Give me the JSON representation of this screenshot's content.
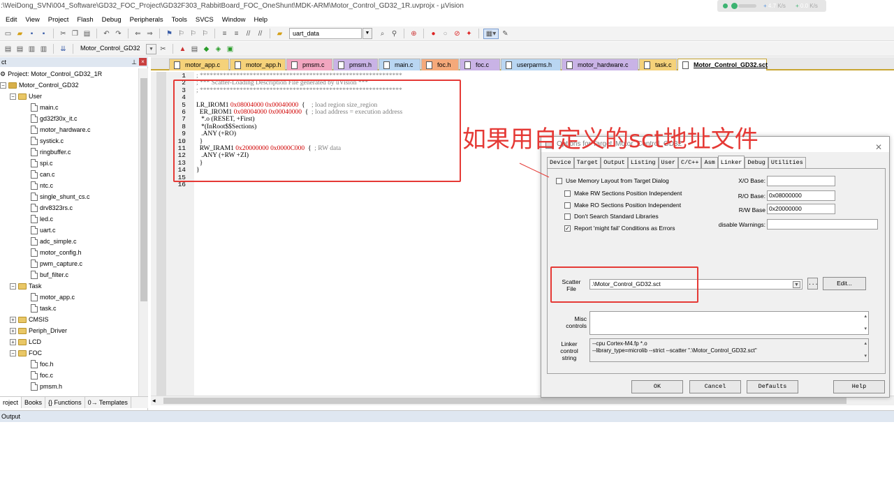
{
  "window": {
    "title": ":\\WeiDong_SVN\\004_Software\\GD32_FOC_Project\\GD32F303_RabbitBoard_FOC_OneShunt\\MDK-ARM\\Motor_Control_GD32_1R.uvprojx - µVision",
    "net_up": "4.7",
    "net_up_unit": "K/s",
    "net_down": "0.0",
    "net_down_unit": "K/s"
  },
  "menu": [
    "Edit",
    "View",
    "Project",
    "Flash",
    "Debug",
    "Peripherals",
    "Tools",
    "SVCS",
    "Window",
    "Help"
  ],
  "toolbar1": {
    "find_combo": "uart_data"
  },
  "toolbar2": {
    "target_combo": "Motor_Control_GD32"
  },
  "project_panel": {
    "header": "ct",
    "root": "Project: Motor_Control_GD32_1R",
    "target": "Motor_Control_GD32",
    "groups": [
      {
        "name": "User",
        "expanded": true,
        "files": [
          "main.c",
          "gd32f30x_it.c",
          "motor_hardware.c",
          "systick.c",
          "ringbuffer.c",
          "spi.c",
          "can.c",
          "ntc.c",
          "single_shunt_cs.c",
          "drv8323rs.c",
          "led.c",
          "uart.c",
          "adc_simple.c",
          "motor_config.h",
          "pwm_capture.c",
          "buf_filter.c"
        ]
      },
      {
        "name": "Task",
        "expanded": true,
        "files": [
          "motor_app.c",
          "task.c"
        ]
      },
      {
        "name": "CMSIS",
        "expanded": false,
        "files": []
      },
      {
        "name": "Periph_Driver",
        "expanded": false,
        "files": []
      },
      {
        "name": "LCD",
        "expanded": false,
        "files": []
      },
      {
        "name": "FOC",
        "expanded": true,
        "files": [
          "foc.h",
          "foc.c",
          "pmsm.h"
        ]
      }
    ],
    "tabs": [
      "roject",
      "Books",
      "{} Functions",
      "0→ Templates"
    ]
  },
  "file_tabs": [
    {
      "label": "motor_app.c",
      "color": "#f5d27a"
    },
    {
      "label": "motor_app.h",
      "color": "#f5d27a"
    },
    {
      "label": "pmsm.c",
      "color": "#f2a6c0"
    },
    {
      "label": "pmsm.h",
      "color": "#c9b3e6"
    },
    {
      "label": "main.c",
      "color": "#b9d6f2"
    },
    {
      "label": "foc.h",
      "color": "#f5a97a"
    },
    {
      "label": "foc.c",
      "color": "#c9b3e6"
    },
    {
      "label": "userparms.h",
      "color": "#b9d6f2"
    },
    {
      "label": "motor_hardware.c",
      "color": "#c9b3e6"
    },
    {
      "label": "task.c",
      "color": "#f5d27a"
    },
    {
      "label": "Motor_Control_GD32.sct",
      "color": "#ffffff"
    }
  ],
  "editor": {
    "line_numbers": [
      "1",
      "2",
      "3",
      "4",
      "5",
      "6",
      "7",
      "8",
      "9",
      "10",
      "11",
      "12",
      "13",
      "14",
      "15",
      "16"
    ],
    "lines": [
      [
        {
          "t": "; *************************************************************",
          "c": "cm"
        }
      ],
      [
        {
          "t": "; *** Scatter-Loading Description File generated by uVision ***",
          "c": "cm"
        }
      ],
      [
        {
          "t": "; *************************************************************",
          "c": "cm"
        }
      ],
      [
        {
          "t": "",
          "c": ""
        }
      ],
      [
        {
          "t": "LR_IROM1 ",
          "c": ""
        },
        {
          "t": "0x08004000 0x00040000",
          "c": "hex"
        },
        {
          "t": "  {    ",
          "c": ""
        },
        {
          "t": "; load region size_region",
          "c": "cm"
        }
      ],
      [
        {
          "t": "  ER_IROM1 ",
          "c": ""
        },
        {
          "t": "0x08004000 0x00040000",
          "c": "hex"
        },
        {
          "t": "  {  ",
          "c": ""
        },
        {
          "t": "; load address = execution address",
          "c": "cm"
        }
      ],
      [
        {
          "t": "   *.o (RESET, +First)",
          "c": ""
        }
      ],
      [
        {
          "t": "   *(InRoot$$Sections)",
          "c": ""
        }
      ],
      [
        {
          "t": "   .ANY (+RO)",
          "c": ""
        }
      ],
      [
        {
          "t": "  }",
          "c": ""
        }
      ],
      [
        {
          "t": "  RW_IRAM1 ",
          "c": ""
        },
        {
          "t": "0x20000000 0x0000C000",
          "c": "hex"
        },
        {
          "t": "  {  ",
          "c": ""
        },
        {
          "t": "; RW data",
          "c": "cm"
        }
      ],
      [
        {
          "t": "   .ANY (+RW +ZI)",
          "c": ""
        }
      ],
      [
        {
          "t": "  }",
          "c": ""
        }
      ],
      [
        {
          "t": "}",
          "c": ""
        }
      ],
      [
        {
          "t": "",
          "c": ""
        }
      ],
      [
        {
          "t": "",
          "c": ""
        }
      ]
    ]
  },
  "output_bar": "Output",
  "annotation": {
    "text": "如果用自定义的sct地址文件",
    "color": "#e53935"
  },
  "dialog": {
    "title": "Options for Target 'Motor_Control_GD32'",
    "tabs": [
      "Device",
      "Target",
      "Output",
      "Listing",
      "User",
      "C/C++",
      "Asm",
      "Linker",
      "Debug",
      "Utilities"
    ],
    "active_tab": "Linker",
    "checkboxes": [
      {
        "label": "Use Memory Layout from Target Dialog",
        "checked": false
      },
      {
        "label": "Make RW Sections Position Independent",
        "checked": false
      },
      {
        "label": "Make RO Sections Position Independent",
        "checked": false
      },
      {
        "label": "Don't Search Standard Libraries",
        "checked": false
      },
      {
        "label": "Report 'might fail' Conditions as Errors",
        "checked": true
      }
    ],
    "xo_label": "X/O Base:",
    "xo_value": "",
    "ro_label": "R/O Base:",
    "ro_value": "0x08000000",
    "rw_label": "R/W Base",
    "rw_value": "0x20000000",
    "warn_label": "disable Warnings:",
    "warn_value": "",
    "scatter_label_1": "Scatter",
    "scatter_label_2": "File",
    "scatter_value": ".\\Motor_Control_GD32.sct",
    "browse_label": "...",
    "edit_label": "Edit...",
    "misc_label_1": "Misc",
    "misc_label_2": "controls",
    "misc_value": "",
    "linker_label_1": "Linker",
    "linker_label_2": "control",
    "linker_label_3": "string",
    "linker_line_1": "--cpu Cortex-M4.fp *.o",
    "linker_line_2": "--library_type=microlib --strict --scatter \".\\Motor_Control_GD32.sct\"",
    "buttons": [
      "OK",
      "Cancel",
      "Defaults",
      "Help"
    ]
  }
}
